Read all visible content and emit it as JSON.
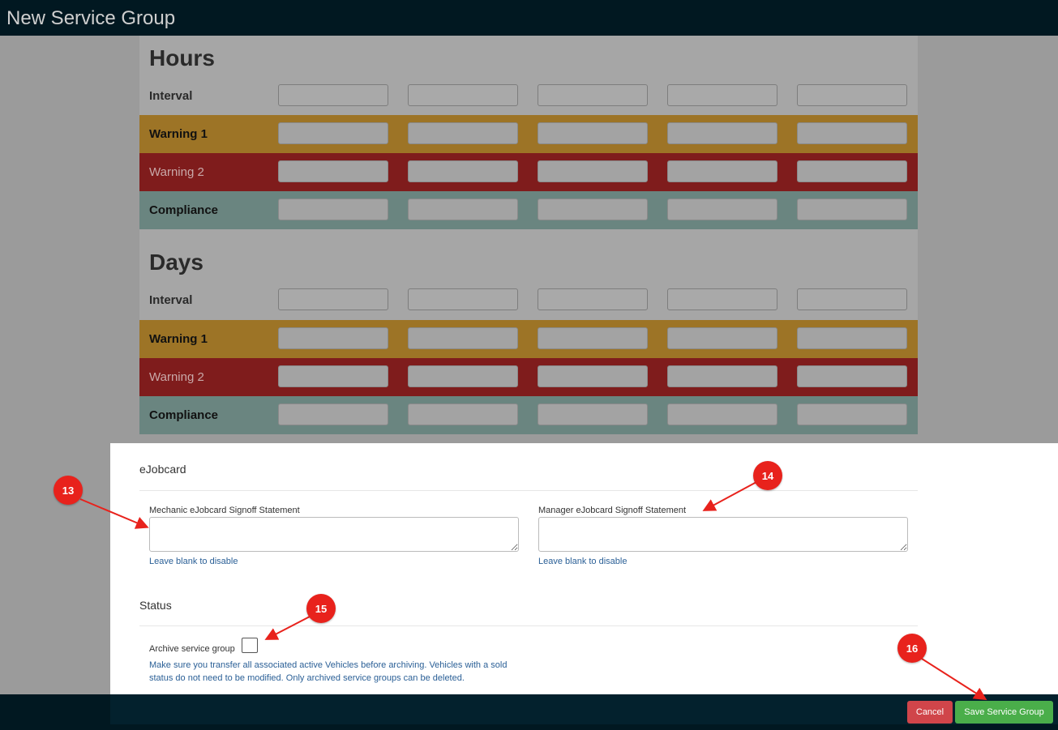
{
  "header": {
    "title": "New Service Group"
  },
  "hours": {
    "heading": "Hours",
    "rows": [
      {
        "label": "Interval"
      },
      {
        "label": "Warning 1"
      },
      {
        "label": "Warning 2"
      },
      {
        "label": "Compliance"
      }
    ]
  },
  "days": {
    "heading": "Days",
    "rows": [
      {
        "label": "Interval"
      },
      {
        "label": "Warning 1"
      },
      {
        "label": "Warning 2"
      },
      {
        "label": "Compliance"
      }
    ]
  },
  "ejobcard": {
    "title": "eJobcard",
    "mechanic_label": "Mechanic eJobcard Signoff Statement",
    "mechanic_value": "",
    "mechanic_help": "Leave blank to disable",
    "manager_label": "Manager eJobcard Signoff Statement",
    "manager_value": "",
    "manager_help": "Leave blank to disable"
  },
  "status": {
    "title": "Status",
    "archive_label": "Archive service group",
    "archive_checked": false,
    "archive_help": "Make sure you transfer all associated active Vehicles before archiving. Vehicles with a sold status do not need to be modified. Only archived service groups can be deleted."
  },
  "footer": {
    "cancel_label": "Cancel",
    "save_label": "Save Service Group"
  },
  "annotations": {
    "a13": "13",
    "a14": "14",
    "a15": "15",
    "a16": "16",
    "color": "#e8221c"
  },
  "colors": {
    "warning1": "#9d7426",
    "warning2": "#7f1c1c",
    "compliance": "#6a8580",
    "cancel": "#d0454a",
    "save": "#4aae4a",
    "bar": "#011821"
  }
}
